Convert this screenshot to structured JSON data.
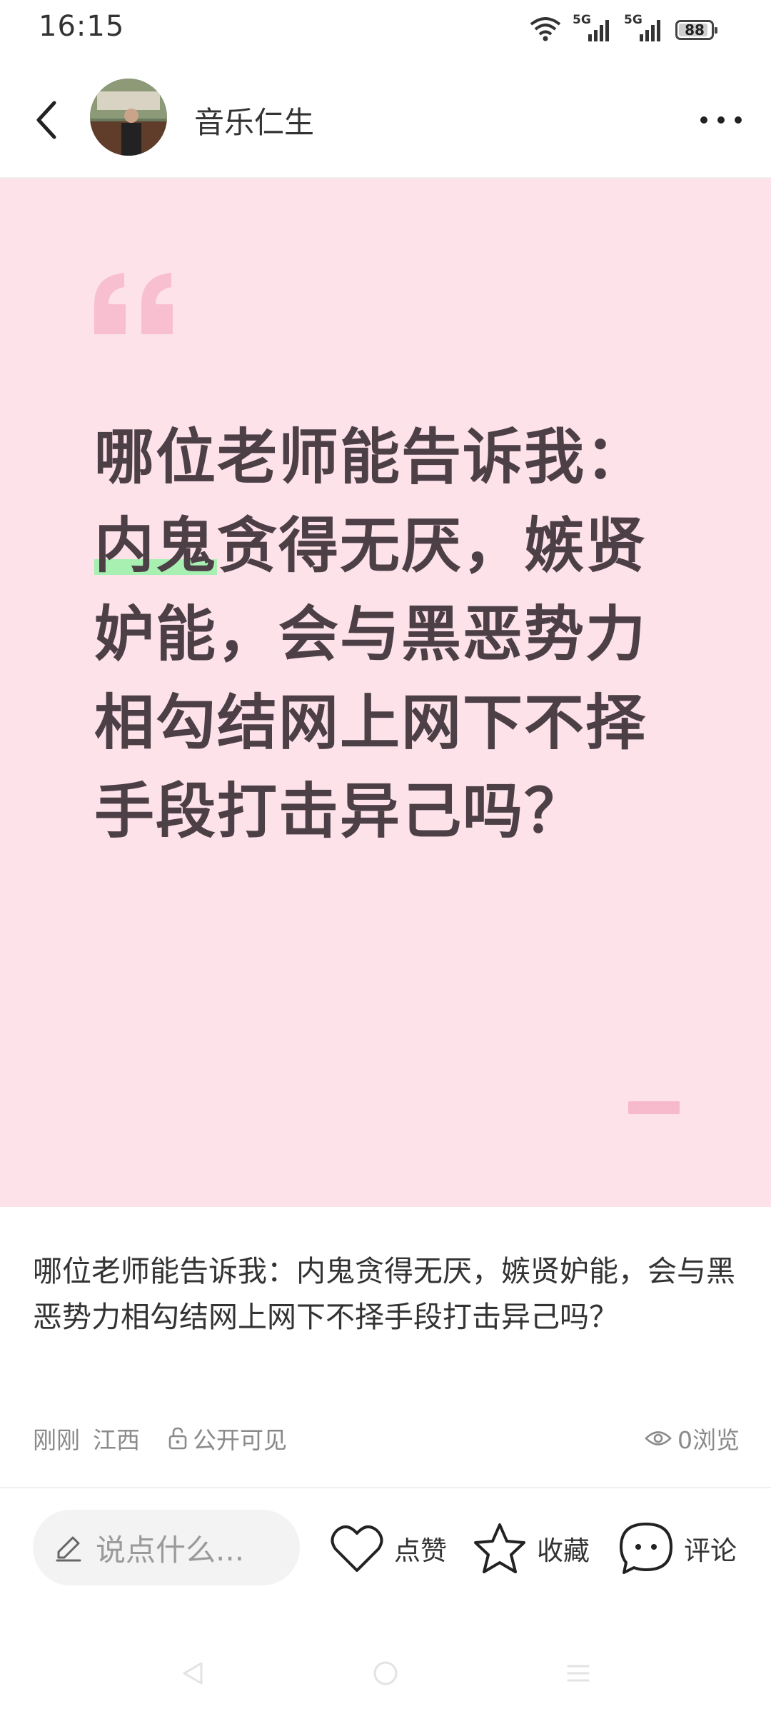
{
  "status_bar": {
    "time": "16:15",
    "net1": "5G",
    "net2": "5G",
    "battery": "88"
  },
  "header": {
    "username": "音乐仁生"
  },
  "card": {
    "text_highlight": "内鬼",
    "text_before": "哪位老师能告诉我：",
    "text_after": "贪得无厌，嫉贤妒能，会与黑恶势力相勾结网上网下不择手段打击异己吗？",
    "background": "#fde2ea",
    "accent": "#f7b9cc"
  },
  "post": {
    "description": "哪位老师能告诉我：内鬼贪得无厌，嫉贤妒能，会与黑恶势力相勾结网上网下不择手段打击异己吗？",
    "time": "刚刚",
    "location": "江西",
    "visibility": "公开可见",
    "views": "0浏览"
  },
  "actions": {
    "comment_placeholder": "说点什么...",
    "like": "点赞",
    "favorite": "收藏",
    "comment": "评论"
  }
}
